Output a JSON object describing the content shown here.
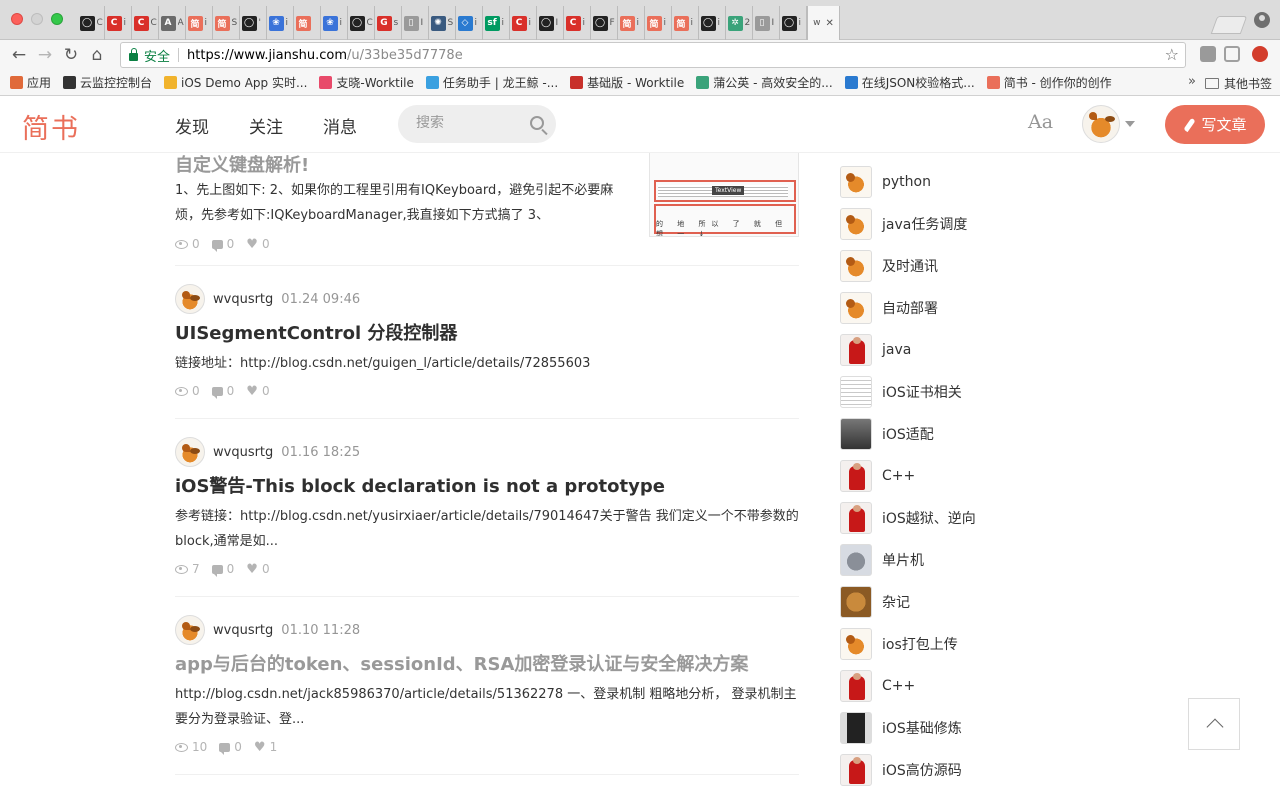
{
  "browser": {
    "tabs": [
      {
        "icon": "github-icon",
        "color": "#222222",
        "glyph": "◯",
        "title": "C"
      },
      {
        "icon": "csdn-icon",
        "color": "#d9302a",
        "glyph": "C",
        "title": "i"
      },
      {
        "icon": "csdn-icon",
        "color": "#d9302a",
        "glyph": "C",
        "title": "C"
      },
      {
        "icon": "translate-icon",
        "color": "#6a6a6a",
        "glyph": "A",
        "title": "A"
      },
      {
        "icon": "jianshu-icon",
        "color": "#ea6f5a",
        "glyph": "简",
        "title": "i"
      },
      {
        "icon": "jianshu-icon",
        "color": "#ea6f5a",
        "glyph": "简",
        "title": "S"
      },
      {
        "icon": "github-icon",
        "color": "#222222",
        "glyph": "◯",
        "title": "'"
      },
      {
        "icon": "baidu-icon",
        "color": "#3a73d9",
        "glyph": "❀",
        "title": "i"
      },
      {
        "icon": "jianshu-icon",
        "color": "#ea6f5a",
        "glyph": "简",
        "title": ""
      },
      {
        "icon": "baidu-icon",
        "color": "#3a73d9",
        "glyph": "❀",
        "title": "i"
      },
      {
        "icon": "github-icon",
        "color": "#222222",
        "glyph": "◯",
        "title": "C"
      },
      {
        "icon": "g-icon",
        "color": "#d9302a",
        "glyph": "G",
        "title": "s"
      },
      {
        "icon": "file-icon",
        "color": "#9a9a9a",
        "glyph": "▯",
        "title": "I"
      },
      {
        "icon": "globe-icon",
        "color": "#3a5a80",
        "glyph": "✺",
        "title": "S"
      },
      {
        "icon": "code-icon",
        "color": "#2a7ad0",
        "glyph": "◇",
        "title": "i"
      },
      {
        "icon": "segmentfault-icon",
        "color": "#009a61",
        "glyph": "sf",
        "title": "i"
      },
      {
        "icon": "csdn-icon",
        "color": "#d9302a",
        "glyph": "C",
        "title": "i"
      },
      {
        "icon": "github-icon",
        "color": "#222222",
        "glyph": "◯",
        "title": "I"
      },
      {
        "icon": "csdn-icon",
        "color": "#d9302a",
        "glyph": "C",
        "title": "i"
      },
      {
        "icon": "github-icon",
        "color": "#222222",
        "glyph": "◯",
        "title": "F"
      },
      {
        "icon": "jianshu-icon",
        "color": "#ea6f5a",
        "glyph": "简",
        "title": "i"
      },
      {
        "icon": "jianshu-icon",
        "color": "#ea6f5a",
        "glyph": "简",
        "title": "i"
      },
      {
        "icon": "jianshu-icon",
        "color": "#ea6f5a",
        "glyph": "简",
        "title": "i"
      },
      {
        "icon": "github-icon",
        "color": "#222222",
        "glyph": "◯",
        "title": "i"
      },
      {
        "icon": "pugongying-icon",
        "color": "#3aa37a",
        "glyph": "✲",
        "title": "2"
      },
      {
        "icon": "file-icon",
        "color": "#9a9a9a",
        "glyph": "▯",
        "title": "I"
      },
      {
        "icon": "github-icon",
        "color": "#222222",
        "glyph": "◯",
        "title": "i"
      }
    ],
    "active_tab": {
      "title": "w",
      "close": "✕"
    },
    "address": {
      "secure_label": "安全",
      "url_host": "https://www.jianshu.com",
      "url_path": "/u/33be35d7778e"
    },
    "bookmarks": [
      {
        "icon": "apps-icon",
        "color": "#e06a3a",
        "label": "应用"
      },
      {
        "icon": "cloud-icon",
        "color": "#333333",
        "label": "云监控控制台"
      },
      {
        "icon": "ios-icon",
        "color": "#f1b32c",
        "label": "iOS Demo App 实时..."
      },
      {
        "icon": "worktile-icon",
        "color": "#e84a6a",
        "label": "支晓-Worktile"
      },
      {
        "icon": "worktile-icon",
        "color": "#3aa0e0",
        "label": "任务助手 | 龙王鲸 -..."
      },
      {
        "icon": "worktile-icon",
        "color": "#c8302a",
        "label": "基础版 - Worktile"
      },
      {
        "icon": "pugongying-icon",
        "color": "#3aa37a",
        "label": "蒲公英 - 高效安全的..."
      },
      {
        "icon": "json-icon",
        "color": "#2a7ad0",
        "label": "在线JSON校验格式..."
      },
      {
        "icon": "jianshu-icon",
        "color": "#ea6f5a",
        "label": "简书 - 创作你的创作"
      }
    ],
    "bookmarks_more": "»",
    "bookmarks_other": "其他书签"
  },
  "header": {
    "logo": "简书",
    "nav": [
      "发现",
      "关注",
      "消息"
    ],
    "search_placeholder": "搜索",
    "font_toggle": "Aa",
    "write_button": "写文章"
  },
  "articles": [
    {
      "title": "自定义键盘解析!",
      "abstract": "1、先上图如下: 2、如果你的工程里引用有IQKeyboard，避免引起不必要麻烦，先参考如下:IQKeyboardManager,我直接如下方式搞了 3、",
      "views": "0",
      "comments": "0",
      "likes": "0",
      "thumb_tip": "TextView",
      "thumb_keys": "的 地 所以 了 就 但 想 一 ↓"
    },
    {
      "author": "wvqusrtg",
      "time": "01.24 09:46",
      "title": "UISegmentControl 分段控制器",
      "abstract": "链接地址：http://blog.csdn.net/guigen_l/article/details/72855603",
      "views": "0",
      "comments": "0",
      "likes": "0"
    },
    {
      "author": "wvqusrtg",
      "time": "01.16 18:25",
      "title": "iOS警告-This block declaration is not a prototype",
      "abstract": "参考链接：http://blog.csdn.net/yusirxiaer/article/details/79014647关于警告 我们定义一个不带参数的block,通常是如...",
      "views": "7",
      "comments": "0",
      "likes": "0"
    },
    {
      "author": "wvqusrtg",
      "time": "01.10 11:28",
      "title": "app与后台的token、sessionId、RSA加密登录认证与安全解决方案",
      "abstract": "http://blog.csdn.net/jack85986370/article/details/51362278 一、登录机制 粗略地分析， 登录机制主要分为登录验证、登...",
      "views": "10",
      "comments": "0",
      "likes": "1"
    }
  ],
  "collections": [
    {
      "name": "python",
      "img": "fox"
    },
    {
      "name": "java任务调度",
      "img": "fox"
    },
    {
      "name": "及时通讯",
      "img": "fox"
    },
    {
      "name": "自动部署",
      "img": "fox"
    },
    {
      "name": "java",
      "img": "red"
    },
    {
      "name": "iOS证书相关",
      "img": "doc"
    },
    {
      "name": "iOS适配",
      "img": "dark"
    },
    {
      "name": "C++",
      "img": "red"
    },
    {
      "name": "iOS越狱、逆向",
      "img": "red"
    },
    {
      "name": "单片机",
      "img": "bird"
    },
    {
      "name": "杂记",
      "img": "cat"
    },
    {
      "name": "ios打包上传",
      "img": "fox"
    },
    {
      "name": "C++",
      "img": "red"
    },
    {
      "name": "iOS基础修炼",
      "img": "phone"
    },
    {
      "name": "iOS高仿源码",
      "img": "red"
    }
  ],
  "colors": {
    "brand": "#ea6f5a",
    "meta": "#b4b4b4"
  }
}
